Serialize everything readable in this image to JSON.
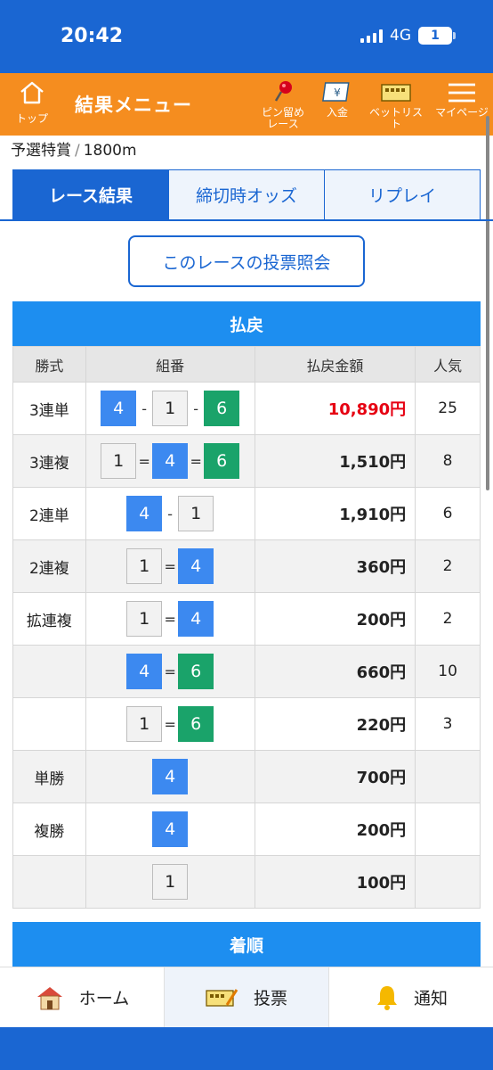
{
  "status": {
    "time": "20:42",
    "network": "4G",
    "battery": "1"
  },
  "header": {
    "home_label": "トップ",
    "title": "結果メニュー",
    "pin_label_1": "ピン留め",
    "pin_label_2": "レース",
    "deposit_label": "入金",
    "betlist_label": "ベットリスト",
    "mypage_label": "マイページ",
    "brand_color": "#f58d1f"
  },
  "breadcrumb": {
    "race": "予選特賞",
    "separator": "/",
    "distance": "1800m"
  },
  "tabs": [
    {
      "label": "レース結果",
      "active": true
    },
    {
      "label": "締切時オッズ",
      "active": false
    },
    {
      "label": "リプレイ",
      "active": false
    }
  ],
  "vote_inquiry_label": "このレースの投票照会",
  "payout": {
    "title": "払戻",
    "headers": {
      "type": "勝式",
      "combo": "組番",
      "amount": "払戻金額",
      "popularity": "人気"
    },
    "rows": [
      {
        "type": "3連単",
        "nums": [
          "4",
          "1",
          "6"
        ],
        "ops": [
          "-",
          "-"
        ],
        "amount": "10,890円",
        "popularity": "25"
      },
      {
        "type": "3連複",
        "nums": [
          "1",
          "4",
          "6"
        ],
        "ops": [
          "=",
          "="
        ],
        "amount": "1,510円",
        "popularity": "8"
      },
      {
        "type": "2連単",
        "nums": [
          "4",
          "1"
        ],
        "ops": [
          "-"
        ],
        "amount": "1,910円",
        "popularity": "6"
      },
      {
        "type": "2連複",
        "nums": [
          "1",
          "4"
        ],
        "ops": [
          "="
        ],
        "amount": "360円",
        "popularity": "2"
      },
      {
        "type": "拡連複",
        "nums": [
          "1",
          "4"
        ],
        "ops": [
          "="
        ],
        "amount": "200円",
        "popularity": "2"
      },
      {
        "type": "",
        "nums": [
          "4",
          "6"
        ],
        "ops": [
          "="
        ],
        "amount": "660円",
        "popularity": "10"
      },
      {
        "type": "",
        "nums": [
          "1",
          "6"
        ],
        "ops": [
          "="
        ],
        "amount": "220円",
        "popularity": "3"
      },
      {
        "type": "単勝",
        "nums": [
          "4"
        ],
        "ops": [],
        "amount": "700円",
        "popularity": ""
      },
      {
        "type": "複勝",
        "nums": [
          "4"
        ],
        "ops": [],
        "amount": "200円",
        "popularity": ""
      },
      {
        "type": "",
        "nums": [
          "1"
        ],
        "ops": [],
        "amount": "100円",
        "popularity": ""
      }
    ],
    "highlight_color": "#e60012"
  },
  "finish_order_title": "着順",
  "bottom_nav": {
    "home": "ホーム",
    "vote": "投票",
    "notify": "通知"
  },
  "colors": {
    "primary": "#1a66d2",
    "section": "#1d8ef0",
    "boat_1": "#f2f2f2",
    "boat_4": "#3c89f0",
    "boat_6": "#1aa36a"
  }
}
